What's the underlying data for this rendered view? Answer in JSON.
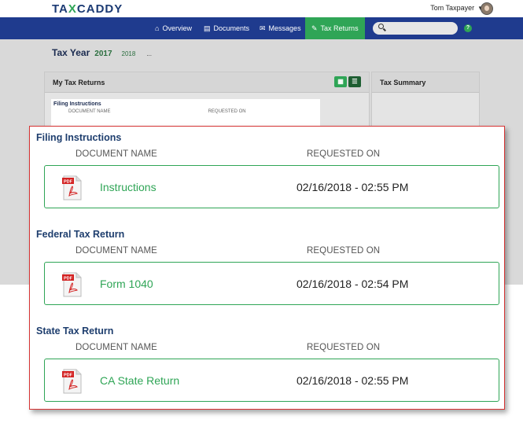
{
  "app": {
    "logo": {
      "part1": "TA",
      "x": "X",
      "part2": "CADDY"
    },
    "user_name": "Tom Taxpayer",
    "help_label": "?"
  },
  "nav": {
    "items": [
      {
        "label": "Overview",
        "icon": "home-icon"
      },
      {
        "label": "Documents",
        "icon": "document-icon"
      },
      {
        "label": "Messages",
        "icon": "message-icon"
      },
      {
        "label": "Tax Returns",
        "icon": "tax-return-icon",
        "active": true
      }
    ],
    "search_placeholder": ""
  },
  "year_bar": {
    "label": "Tax Year",
    "year": "2017",
    "other_year": "2018",
    "more": "..."
  },
  "panels": {
    "left_title": "My Tax Returns",
    "right_title": "Tax Summary",
    "mini": {
      "title": "Filing Instructions",
      "col_doc": "DOCUMENT NAME",
      "col_req": "REQUESTED ON"
    }
  },
  "sections": [
    {
      "title": "Filing Instructions",
      "col_doc": "DOCUMENT NAME",
      "col_req": "REQUESTED ON",
      "doc": {
        "name": "Instructions",
        "date": "02/16/2018 - 02:55 PM",
        "icon": "pdf-icon"
      }
    },
    {
      "title": "Federal Tax Return",
      "col_doc": "DOCUMENT NAME",
      "col_req": "REQUESTED ON",
      "doc": {
        "name": "Form 1040",
        "date": "02/16/2018 - 02:54 PM",
        "icon": "pdf-icon"
      }
    },
    {
      "title": "State Tax Return",
      "col_doc": "DOCUMENT NAME",
      "col_req": "REQUESTED ON",
      "doc": {
        "name": "CA State Return",
        "date": "02/16/2018 - 02:55 PM",
        "icon": "pdf-icon"
      }
    }
  ],
  "colors": {
    "nav_bg": "#1f3b8e",
    "accent_green": "#2fa556",
    "title_blue": "#1e3e6e",
    "callout_border": "#d63333"
  }
}
